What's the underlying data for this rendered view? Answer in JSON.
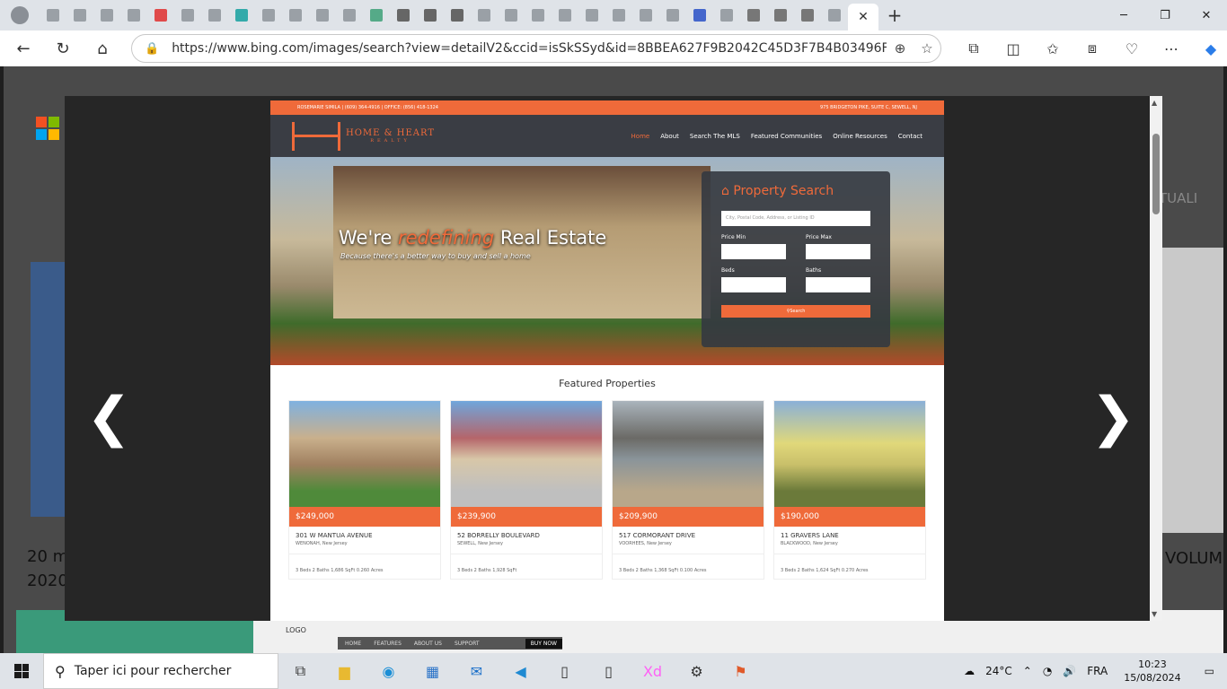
{
  "browser": {
    "url": "https://www.bing.com/images/search?view=detailV2&ccid=isSkSSyd&id=8BBEA627F9B2042C45D3F7B4B03496F7EEC1573...",
    "active_tab_close": "✕",
    "new_tab": "+"
  },
  "background": {
    "left_caption_line1": "20 m",
    "left_caption_line2": "2020",
    "right_caption": "VOLUM",
    "right_nav_text": "TUALI",
    "logo_text": "LOGO",
    "nav_items": [
      "HOME",
      "FEATURES",
      "ABOUT US",
      "SUPPORT"
    ],
    "buy_now": "BUY NOW"
  },
  "preview": {
    "topbar_left": "ROSEMARIE SIMILA | (609) 364-4916 | OFFICE: (856) 418-1324",
    "topbar_right": "975 BRIDGETON PIKE, SUITE C, SEWELL, NJ",
    "brand": "HOME & HEART",
    "brand_sub": "REALTY",
    "menu": [
      "Home",
      "About",
      "Search The MLS",
      "Featured Communities",
      "Online Resources",
      "Contact"
    ],
    "hero_title_pre": "We're ",
    "hero_title_em": "redefining",
    "hero_title_post": " Real Estate",
    "hero_sub": "Because there's a better way to buy and sell a home",
    "search_title": "Property Search",
    "search_placeholder": "City, Postal Code, Address, or Listing ID",
    "price_min": "Price Min",
    "price_max": "Price Max",
    "beds": "Beds",
    "baths": "Baths",
    "search_button": "Search",
    "featured_title": "Featured Properties",
    "cards": [
      {
        "price": "$249,000",
        "address": "301 W MANTUA AVENUE",
        "city": "WENONAH, New Jersey",
        "meta": "3 Beds    2 Baths    1,686 SqFt    0.260 Acres"
      },
      {
        "price": "$239,900",
        "address": "52 BORRELLY BOULEVARD",
        "city": "SEWELL, New Jersey",
        "meta": "3 Beds    2 Baths    1,928 SqFt"
      },
      {
        "price": "$209,900",
        "address": "517 CORMORANT DRIVE",
        "city": "VOORHEES, New Jersey",
        "meta": "3 Beds    2 Baths    1,368 SqFt    0.100 Acres"
      },
      {
        "price": "$190,000",
        "address": "11 GRAVERS LANE",
        "city": "BLACKWOOD, New Jersey",
        "meta": "3 Beds    2 Baths    1,624 SqFt    0.270 Acres"
      }
    ]
  },
  "taskbar": {
    "search_placeholder": "Taper ici pour rechercher",
    "temperature": "24°C",
    "language": "FRA",
    "time": "10:23",
    "date": "15/08/2024"
  },
  "colors": {
    "accent": "#ef6a3a",
    "header_dark": "#3a3d44"
  }
}
